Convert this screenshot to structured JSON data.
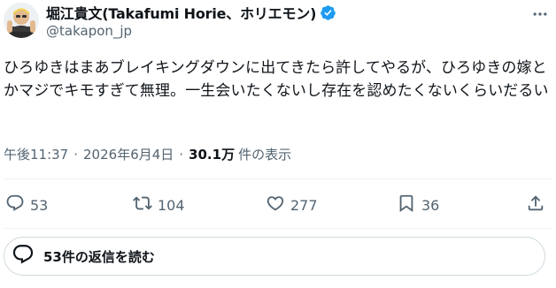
{
  "author": {
    "name": "堀江貴文(Takafumi Horie、ホリエモン)",
    "handle": "@takapon_jp",
    "verified_color": "#1d9bf0"
  },
  "tweet": {
    "text": "ひろゆきはまあブレイキングダウンに出てきたら許してやるが、ひろゆきの嫁とかマジでキモすぎて無理。一生会いたくないし存在を認めたくないくらいだるい"
  },
  "meta": {
    "time": "午後11:37",
    "separator": "·",
    "date": "2026年6月4日",
    "views_count": "30.1万",
    "views_label": "件の表示"
  },
  "actions": {
    "replies": "53",
    "retweets": "104",
    "likes": "277",
    "bookmarks": "36"
  },
  "replies_button": {
    "label": "53件の返信を読む"
  },
  "icons": [
    "verified-badge-icon",
    "more-options-icon",
    "reply-icon",
    "retweet-icon",
    "like-icon",
    "bookmark-icon",
    "share-icon",
    "speech-bubble-icon"
  ]
}
